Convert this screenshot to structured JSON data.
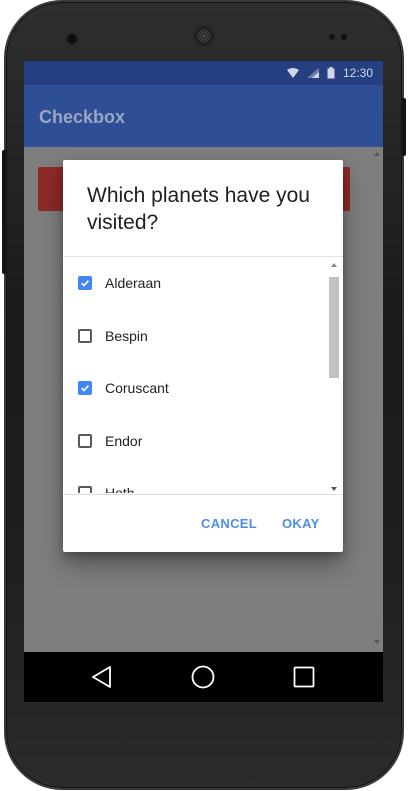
{
  "status_bar": {
    "time": "12:30",
    "icons": [
      "wifi-icon",
      "signal-icon",
      "battery-icon"
    ]
  },
  "action_bar": {
    "title": "Checkbox"
  },
  "dialog": {
    "title": "Which planets have you visited?",
    "items": [
      {
        "label": "Alderaan",
        "checked": true
      },
      {
        "label": "Bespin",
        "checked": false
      },
      {
        "label": "Coruscant",
        "checked": true
      },
      {
        "label": "Endor",
        "checked": false
      },
      {
        "label": "Hoth",
        "checked": false
      }
    ],
    "cancel_label": "CANCEL",
    "okay_label": "OKAY"
  },
  "nav_bar": {
    "icons": [
      "back-icon",
      "home-icon",
      "recents-icon"
    ]
  },
  "colors": {
    "status_bar": "#253f80",
    "action_bar": "#2e4e96",
    "accent": "#4285f4",
    "button_text": "#4f8ee8",
    "red_button": "#8e2a26"
  }
}
